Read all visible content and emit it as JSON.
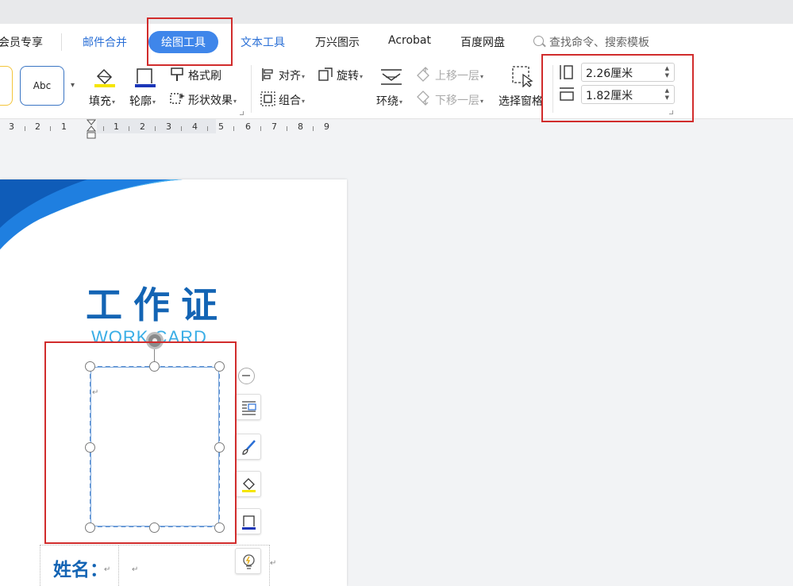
{
  "menu": {
    "items": [
      "会员专享",
      "邮件合并",
      "绘图工具",
      "文本工具",
      "万兴图示",
      "Acrobat",
      "百度网盘"
    ],
    "active": "绘图工具",
    "search_placeholder": "查找命令、搜索模板"
  },
  "ribbon": {
    "style_sample": "Abc",
    "fill": "填充",
    "outline": "轮廓",
    "format_painter": "格式刷",
    "shape_effect": "形状效果",
    "align": "对齐",
    "rotate": "旋转",
    "group": "组合",
    "wrap": "环绕",
    "bring_forward": "上移一层",
    "send_backward": "下移一层",
    "selection_pane": "选择窗格",
    "height_value": "2.26厘米",
    "width_value": "1.82厘米"
  },
  "ruler": {
    "numbers": [
      "3",
      "2",
      "1",
      "1",
      "2",
      "3",
      "4",
      "5",
      "6",
      "7",
      "8",
      "9"
    ]
  },
  "document": {
    "title": "工作证",
    "subtitle": "WORK CARD",
    "name_label": "姓名：",
    "paragraph_mark": "↵"
  },
  "colors": {
    "accent": "#3f86ea",
    "highlight_box": "#d12c2c",
    "title_blue": "#1364b4",
    "subtitle_blue": "#3aaee6"
  }
}
